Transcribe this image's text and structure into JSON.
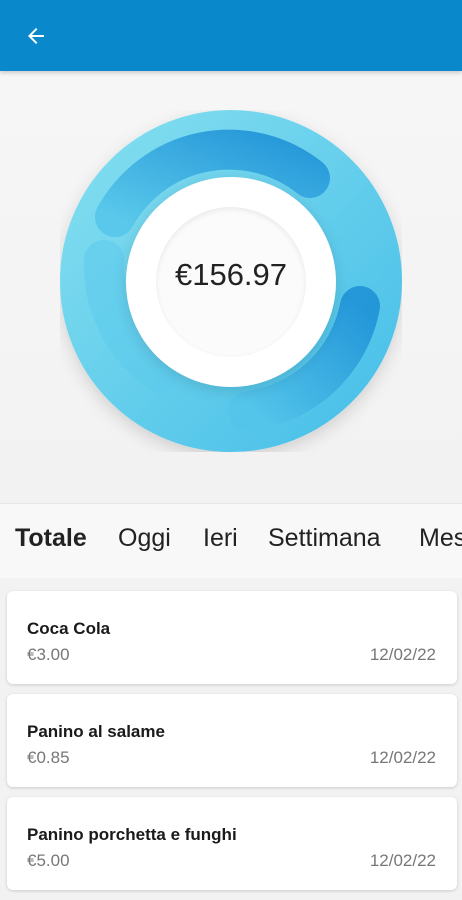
{
  "appbar": {
    "back_icon": "arrow-left-icon",
    "color": "#0a88cc"
  },
  "summary": {
    "total": "€156.97",
    "ring_colors": [
      "#6fd6ec",
      "#3ab8e6",
      "#1b8fd6"
    ]
  },
  "tabs": [
    {
      "label": "Totale",
      "active": true
    },
    {
      "label": "Oggi",
      "active": false
    },
    {
      "label": "Ieri",
      "active": false
    },
    {
      "label": "Settimana",
      "active": false
    },
    {
      "label": "Mes",
      "active": false
    }
  ],
  "transactions": [
    {
      "name": "Coca Cola",
      "price": "€3.00",
      "date": "12/02/22"
    },
    {
      "name": "Panino al salame",
      "price": "€0.85",
      "date": "12/02/22"
    },
    {
      "name": "Panino porchetta e funghi",
      "price": "€5.00",
      "date": "12/02/22"
    }
  ]
}
